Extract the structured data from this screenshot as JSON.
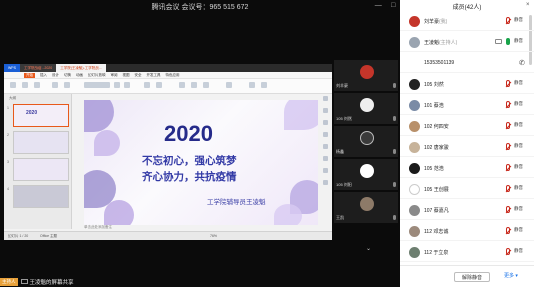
{
  "meeting": {
    "title": "腾讯会议 会议号：965 515 672",
    "sharer_tag": "主持人",
    "share_banner": "王凌魁的屏幕共享"
  },
  "wps": {
    "tabs": [
      "WPS",
      "工学院战疫...2020",
      "工学院(王凌魁)-工学院战..."
    ],
    "menu": [
      "开始",
      "插入",
      "设计",
      "切换",
      "动画",
      "幻灯片放映",
      "审阅",
      "视图",
      "安全",
      "开发工具",
      "特色应用"
    ],
    "active_menu": "开始",
    "thumbs_label": "大纲",
    "status_left": "幻灯片 1 / 20",
    "status_theme": "Office 主题",
    "notes_hint": "单击此处添加备注",
    "zoom": "76%"
  },
  "slide": {
    "year": "2020",
    "line1": "不忘初心，强心筑梦",
    "line2": "齐心协力，共抗疫情",
    "byline": "工学院辅导员王凌魁"
  },
  "tiles": [
    {
      "name": "刘羊豪",
      "color": "#c4352a"
    },
    {
      "name": "105 刘然",
      "color": "#eeeeee"
    },
    {
      "name": "杨鑫",
      "color": "#3a3a3a"
    },
    {
      "name": "105 刘阳",
      "color": "#ffffff"
    },
    {
      "name": "王凯",
      "color": "#8d7a68"
    }
  ],
  "panel": {
    "title": "成员(42人)",
    "close": "×",
    "members": [
      {
        "name": "刘羊豪",
        "tag": "(我)",
        "mic": "muted",
        "label": "静音",
        "avatar": "#c4352a"
      },
      {
        "name": "王凌魁",
        "tag": "(主持人)",
        "mic": "on",
        "label": "静音",
        "avatar": "#9aa4b0",
        "camera": true
      },
      {
        "name": "15353501139",
        "tag": "",
        "mic": "phone",
        "label": "",
        "avatar": ""
      },
      {
        "name": "105 刘然",
        "tag": "",
        "mic": "muted",
        "label": "静音",
        "avatar": "#222222"
      },
      {
        "name": "101 蔡浩",
        "tag": "",
        "mic": "muted",
        "label": "静音",
        "avatar": "#7a8ba6"
      },
      {
        "name": "102 何四安",
        "tag": "",
        "mic": "muted",
        "label": "静音",
        "avatar": "#b8906a"
      },
      {
        "name": "102 唐家骏",
        "tag": "",
        "mic": "muted",
        "label": "静音",
        "avatar": "#c7b39a"
      },
      {
        "name": "105 范浩",
        "tag": "",
        "mic": "muted",
        "label": "静音",
        "avatar": "#1a1a1a"
      },
      {
        "name": "105 王创展",
        "tag": "",
        "mic": "muted",
        "label": "静音",
        "avatar": "#ffffff"
      },
      {
        "name": "107 蔡嘉凡",
        "tag": "",
        "mic": "muted",
        "label": "静音",
        "avatar": "#8a8a8a"
      },
      {
        "name": "112 邓志诚",
        "tag": "",
        "mic": "muted",
        "label": "静音",
        "avatar": "#9c8a7c"
      },
      {
        "name": "112 于立泉",
        "tag": "",
        "mic": "muted",
        "label": "静音",
        "avatar": "#6d7f70"
      }
    ],
    "mute_all": "解除静音",
    "more": "更多 ▾"
  }
}
